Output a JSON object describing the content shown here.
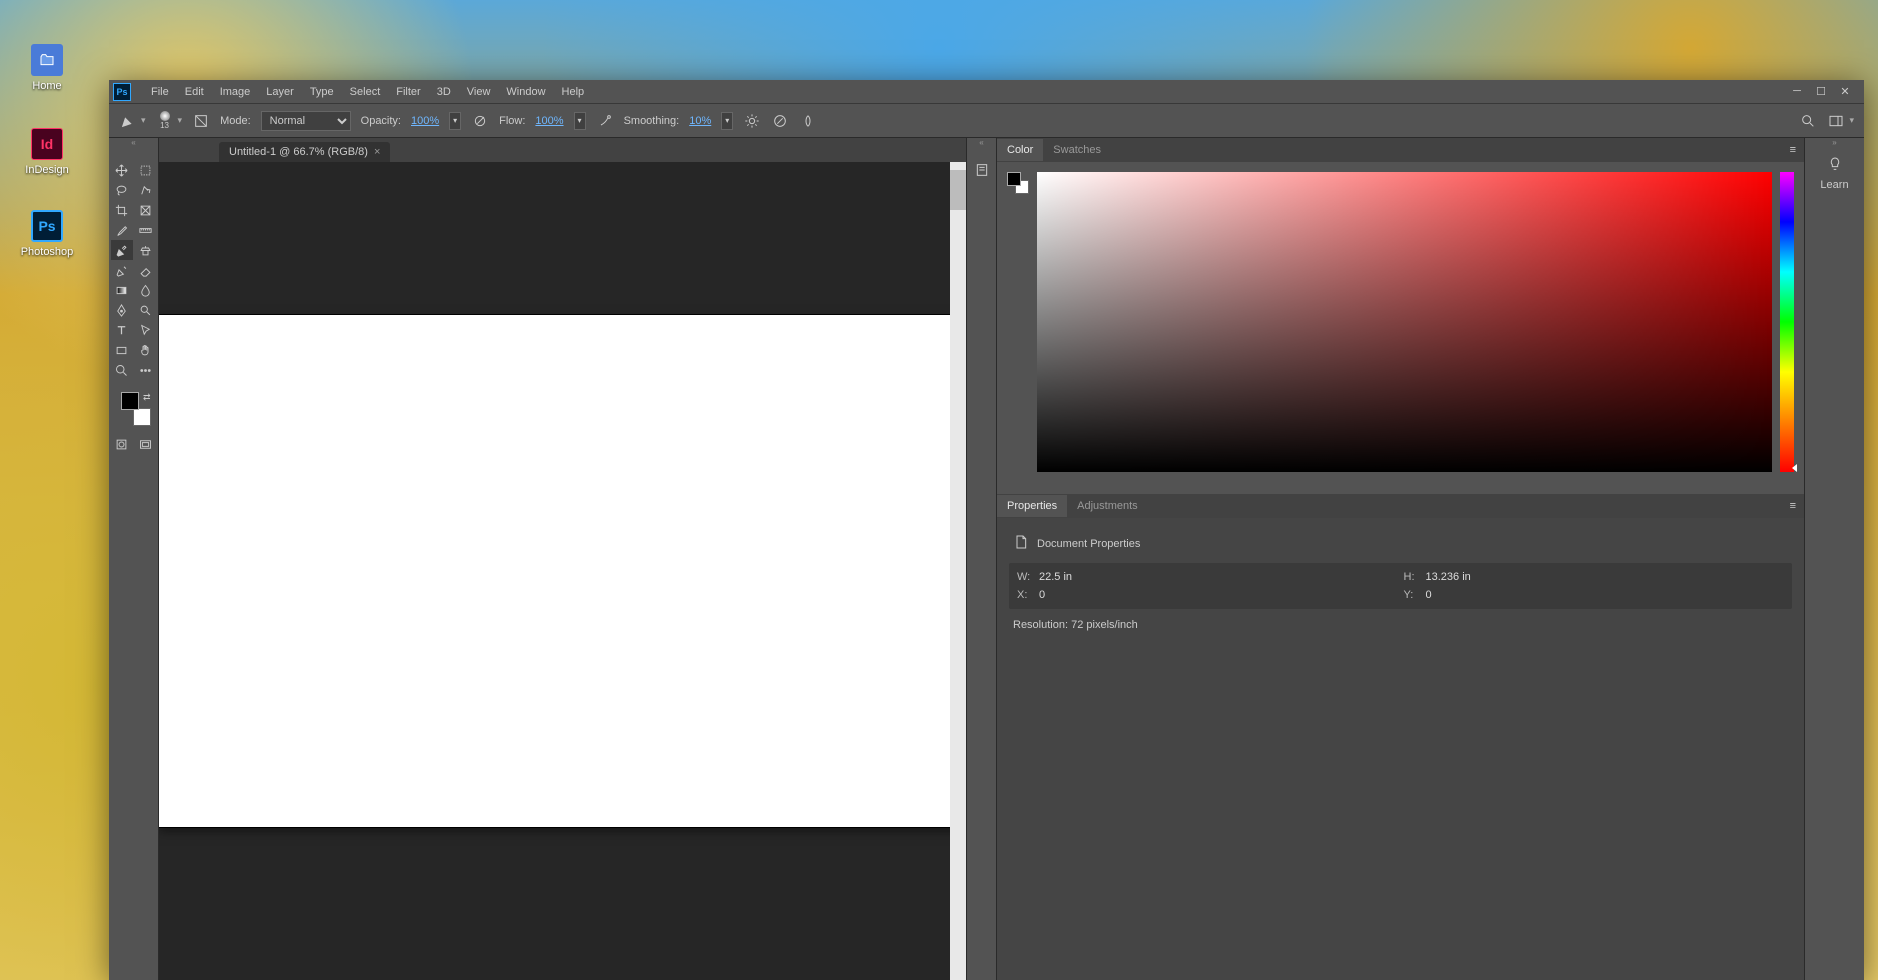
{
  "desktop_icons": {
    "home": {
      "label": "Home"
    },
    "indesign": {
      "label": "InDesign",
      "badge": "Id"
    },
    "photoshop": {
      "label": "Photoshop",
      "badge": "Ps"
    }
  },
  "menubar": {
    "logo": "Ps",
    "items": [
      "File",
      "Edit",
      "Image",
      "Layer",
      "Type",
      "Select",
      "Filter",
      "3D",
      "View",
      "Window",
      "Help"
    ]
  },
  "options": {
    "brush_size": "13",
    "mode_label": "Mode:",
    "mode_value": "Normal",
    "opacity_label": "Opacity:",
    "opacity_value": "100%",
    "flow_label": "Flow:",
    "flow_value": "100%",
    "smoothing_label": "Smoothing:",
    "smoothing_value": "10%"
  },
  "document_tab": {
    "title": "Untitled-1 @ 66.7% (RGB/8)"
  },
  "tools": {
    "left_col": [
      "move",
      "lasso",
      "crop",
      "eyedropper",
      "brush",
      "clone",
      "gradient",
      "pen",
      "type",
      "rectangle",
      "zoom"
    ],
    "right_col": [
      "marquee",
      "magic-wand",
      "frame",
      "ruler",
      "stamp",
      "eraser",
      "blur",
      "dodge",
      "path-select",
      "hand",
      "more"
    ]
  },
  "right_panels": {
    "color_tab": "Color",
    "swatches_tab": "Swatches",
    "properties_tab": "Properties",
    "adjustments_tab": "Adjustments",
    "doc_props_label": "Document Properties",
    "w_label": "W:",
    "w_value": "22.5 in",
    "h_label": "H:",
    "h_value": "13.236 in",
    "x_label": "X:",
    "x_value": "0",
    "y_label": "Y:",
    "y_value": "0",
    "res_label": "Resolution:",
    "res_value": "72 pixels/inch"
  },
  "learn_label": "Learn"
}
